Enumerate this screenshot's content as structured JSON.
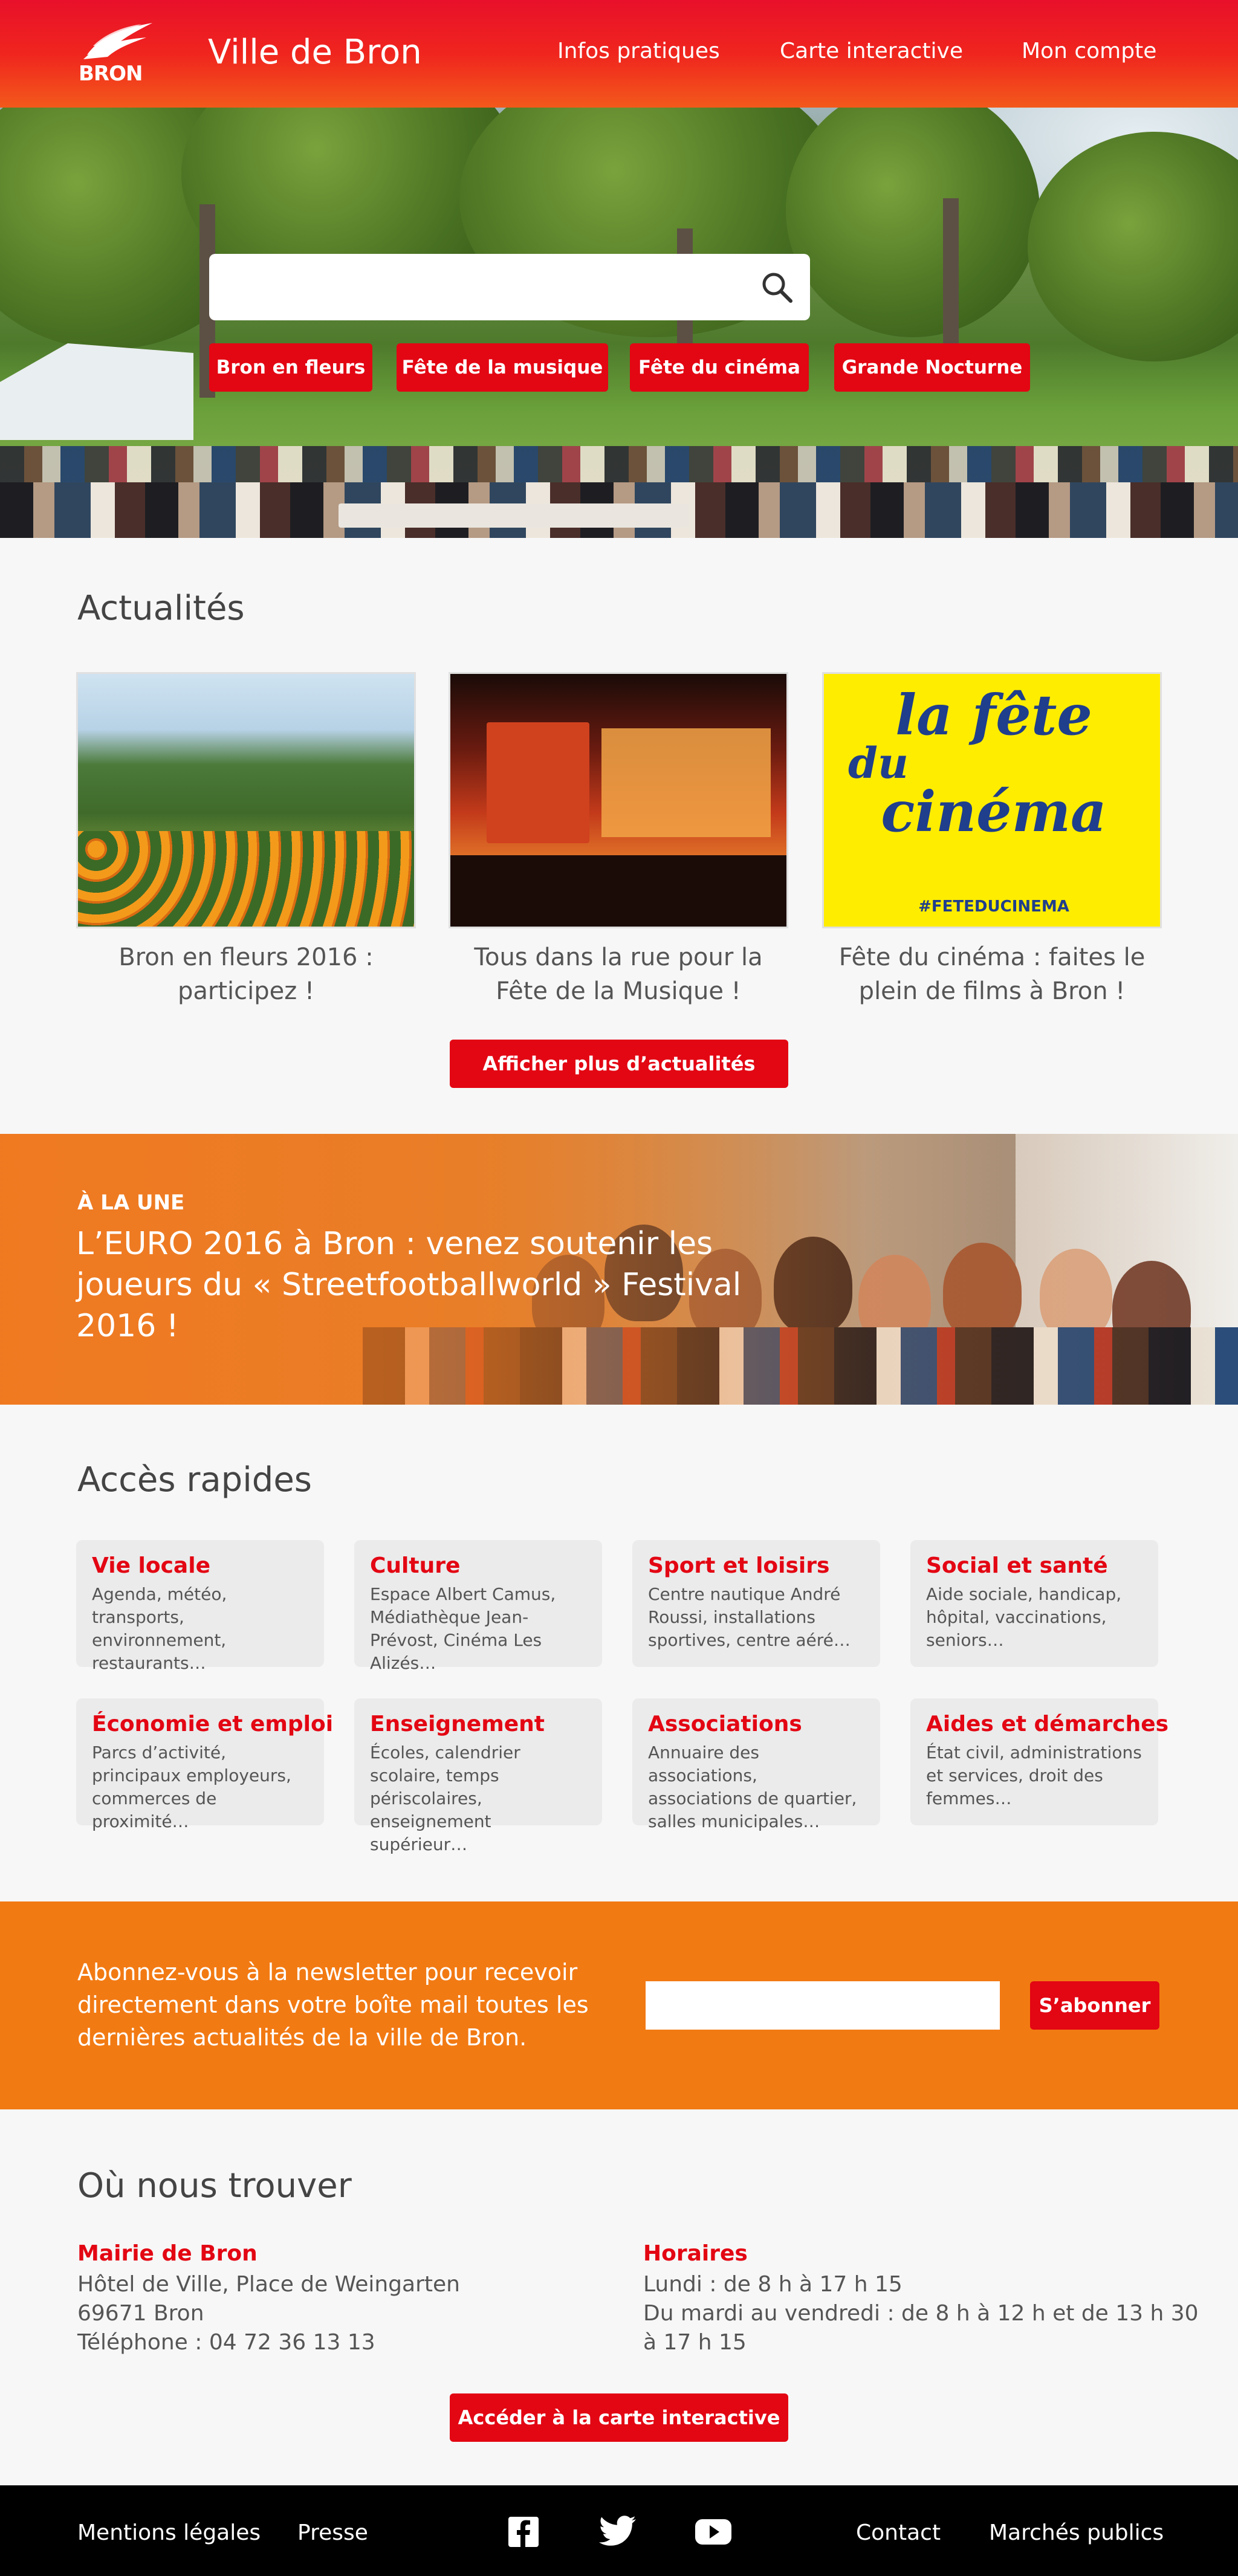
{
  "header": {
    "logo_text": "BRON",
    "site_title": "Ville de Bron",
    "nav": [
      "Infos pratiques",
      "Carte interactive",
      "Mon compte"
    ]
  },
  "hero": {
    "search_placeholder": "",
    "tags": [
      "Bron en fleurs",
      "Fête de la musique",
      "Fête du cinéma",
      "Grande Nocturne"
    ]
  },
  "news": {
    "title": "Actualités",
    "items": [
      {
        "caption_l1": "Bron en fleurs 2016 :",
        "caption_l2": "participez !"
      },
      {
        "caption_l1": "Tous dans la rue pour la",
        "caption_l2": "Fête de la Musique !"
      },
      {
        "caption_l1": "Fête du cinéma : faites le",
        "caption_l2": "plein de films à Bron !"
      }
    ],
    "poster": {
      "line1": "la fête",
      "line2": "du",
      "line3": "cinéma",
      "hashtag": "#FETEDUCINEMA"
    },
    "more_button": "Afficher plus d’actualités"
  },
  "une": {
    "kicker": "À LA UNE",
    "title": "L’EURO 2016 à Bron : venez soutenir les joueurs du « Streetfootballworld » Festival 2016 !"
  },
  "quick": {
    "title": "Accès rapides",
    "cards": [
      {
        "title": "Vie locale",
        "desc": "Agenda, météo, transports, environnement, restaurants…"
      },
      {
        "title": "Culture",
        "desc": "Espace Albert Camus, Médiathèque Jean-Prévost, Cinéma Les Alizés…"
      },
      {
        "title": "Sport et loisirs",
        "desc": "Centre nautique André Roussi, installations sportives, centre aéré…"
      },
      {
        "title": "Social et santé",
        "desc": "Aide sociale, handicap, hôpital, vaccinations, seniors…"
      },
      {
        "title": "Économie et emploi",
        "desc": "Parcs d’activité, principaux employeurs, commerces de proximité…"
      },
      {
        "title": "Enseignement",
        "desc": "Écoles, calendrier scolaire, temps périscolaires, enseignement supérieur…"
      },
      {
        "title": "Associations",
        "desc": "Annuaire des associations, associations de quartier, salles municipales…"
      },
      {
        "title": "Aides et démarches",
        "desc": "État civil, administrations et services, droit des femmes…"
      }
    ]
  },
  "newsletter": {
    "text": "Abonnez-vous à la newsletter pour recevoir directement dans votre boîte mail toutes les dernières actualités de la ville de Bron.",
    "input_value": "",
    "button": "S’abonner"
  },
  "location": {
    "title": "Où nous trouver",
    "mairie_title": "Mairie de Bron",
    "mairie_lines": [
      "Hôtel de Ville, Place de Weingarten",
      "69671 Bron",
      "Téléphone : 04 72 36 13 13"
    ],
    "hours_title": "Horaires",
    "hours_lines": [
      "Lundi : de 8 h à 17 h 15",
      "Du mardi au vendredi : de 8 h à 12 h et de 13 h 30",
      "à 17 h 15"
    ],
    "map_button": "Accéder à la carte interactive"
  },
  "footer": {
    "links_left": [
      "Mentions légales",
      "Presse"
    ],
    "links_right": [
      "Contact",
      "Marchés publics"
    ],
    "social": [
      "facebook-icon",
      "twitter-icon",
      "youtube-icon"
    ]
  },
  "colors": {
    "brand_red": "#e30613",
    "orange": "#f27a13"
  }
}
